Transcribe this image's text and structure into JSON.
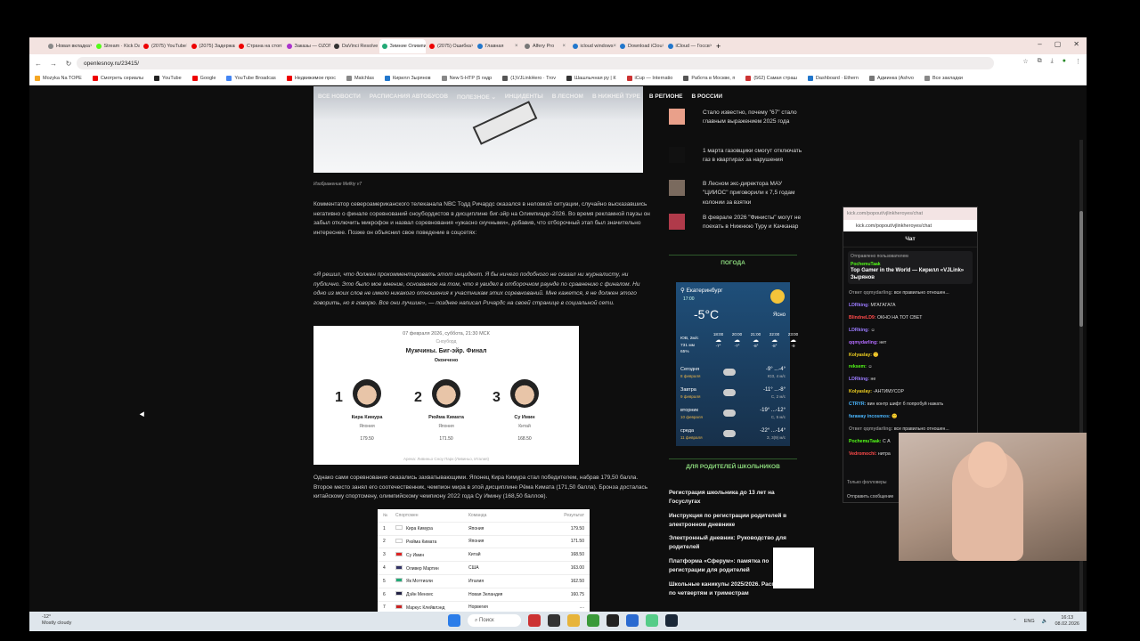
{
  "browser": {
    "tabs": [
      {
        "label": "Новая вкладка",
        "color": "#888"
      },
      {
        "label": "Stream · Kick Da",
        "color": "#53fc18"
      },
      {
        "label": "(2075) YouTube",
        "color": "#e00"
      },
      {
        "label": "(2075) Задержан",
        "color": "#e00"
      },
      {
        "label": "Страна на стоп",
        "color": "#e00"
      },
      {
        "label": "Заказы — OZON",
        "color": "#a3c"
      },
      {
        "label": "DaVinci Resolve",
        "color": "#333"
      },
      {
        "label": "Зимние Олимпи",
        "color": "#2a7"
      },
      {
        "label": "(2075) Ошибка",
        "color": "#e00"
      },
      {
        "label": "Главная",
        "color": "#27c"
      },
      {
        "label": "Alfery Pro",
        "color": "#777"
      },
      {
        "label": "icloud windows",
        "color": "#27c"
      },
      {
        "label": "Download iClou",
        "color": "#27c"
      },
      {
        "label": "iCloud — Госсв",
        "color": "#27c"
      }
    ],
    "active_tab_index": 7,
    "url": "openlesnoy.ru/23415/",
    "bookmarks": [
      "Mozyka Na TOPE",
      "Смотреть сериалы",
      "YouTube",
      "Google",
      "YouTube Broadcas",
      "Недвижимое прос",
      "Matchlas",
      "Кирилл Зырянов",
      "New 5-HTP (5 гидр",
      "(1)VJLinkHero · Trov",
      "Шашлычная ру | К",
      "iCup — Internatio",
      "Работа в Москве, п",
      "(562) Самая страш",
      "Dashboard · Ethern",
      "Админка (Ashvo",
      "Все закладки"
    ]
  },
  "site": {
    "nav": [
      "ВСЕ НОВОСТИ",
      "РАСПИСАНИЯ АВТОБУСОВ",
      "ПОЛЕЗНОЕ ⌄",
      "ИНЦИДЕНТЫ",
      "В ЛЕСНОМ",
      "В НИЖНЕЙ ТУРЕ",
      "В РЕГИОНЕ",
      "В РОССИИ"
    ],
    "caption": "Изображение Mefkiy v7",
    "paragraph1": "Комментатор североамериканского телеканала NBC Тодд Ричардс оказался в неловкой ситуации, случайно высказавшись негативно о финале соревнований сноубордистов в дисциплине биг-эйр на Олимпиаде-2026. Во время рекламной паузы он забыл отключить микрофон и назвал соревнования «ужасно скучными», добавив, что отборочный этап был значительно интереснее. Позже он объяснил свое поведение в соцсетях:",
    "quote": "«Я решил, что должен прокомментировать этот инцидент. Я бы ничего подобного не сказал ни журналисту, ни публично. Это было мое мнение, основанное на том, что я увидел в отборочном раунде по сравнению с финалом. Ни одно из моих слов не имело никакого отношения к участникам этих соревнований. Мне кажется, я не должен этого говорить, но я говорю. Все они лучшие», — позднее написал Ричардс на своей странице в социальной сети.",
    "result_card": {
      "date": "07 февраля 2026, суббота, 21:30 МСК",
      "sport": "Сноуборд",
      "title": "Мужчины. Биг-эйр. Финал",
      "status": "Окончено",
      "podium": [
        {
          "place": "1",
          "name": "Кира Кимура",
          "country": "Япония",
          "score": "179.50"
        },
        {
          "place": "2",
          "name": "Рюйма Кимата",
          "country": "Япония",
          "score": "171.50"
        },
        {
          "place": "3",
          "name": "Су Имин",
          "country": "Китай",
          "score": "168.50"
        }
      ],
      "venue": "Арена: Ливиньо Сноу Парк (Ливиньо, Италия)"
    },
    "paragraph2": "Однако сами соревнования оказались захватывающими. Японец Кира Кимура стал победителем, набрав 179,50 балла. Второе место занял его соотечественник, чемпион мира в этой дисциплине Рёма Кимата (171,50 балла). Бронза досталась китайскому спортсмену, олимпийскому чемпиону 2022 года Су Имину (168,50 баллов).",
    "results_table": {
      "headers": [
        "№",
        "Спортсмен",
        "Команда",
        "Результат"
      ],
      "rows": [
        [
          "1",
          "Кира Кимура",
          "Япония",
          "179.50"
        ],
        [
          "2",
          "Рюйма Кимата",
          "Япония",
          "171.50"
        ],
        [
          "3",
          "Су Имин",
          "Китай",
          "168.50"
        ],
        [
          "4",
          "Оливер Мартин",
          "США",
          "163.00"
        ],
        [
          "5",
          "Як Моттиоли",
          "Италия",
          "162.50"
        ],
        [
          "6",
          "Дэйн Менхес",
          "Новая Зеландия",
          "160.75"
        ],
        [
          "7",
          "Маркус Клейвлэнд",
          "Норвегия",
          "...."
        ]
      ]
    },
    "sidebar_news": [
      "Стало известно, почему \"67\" стало главным выражением 2025 года",
      "1 марта газовщики смогут отключать газ в квартирах за нарушения",
      "В Лесном экс-директора МАУ \"ЦИИОС\" приговорили к 7,5 годам колонии за взятки",
      "В феврале 2026 \"Финисты\" могут не поехать в Нижнюю Туру и Качканар"
    ],
    "weather_title": "ПОГОДА",
    "weather": {
      "city": "Екатеринбург",
      "time": "17:00",
      "temp": "-5°C",
      "cond": "Ясно",
      "details": [
        "ЮВ, 2м/с",
        "731 мм",
        "65%"
      ],
      "hours": [
        {
          "t": "18:00",
          "v": "-7°"
        },
        {
          "t": "20:00",
          "v": "-7°"
        },
        {
          "t": "21:00",
          "v": "-8°"
        },
        {
          "t": "22:00",
          "v": "-8°"
        },
        {
          "t": "23:00",
          "v": "-9"
        }
      ],
      "days": [
        {
          "name": "Сегодня",
          "date": "8 февраля",
          "temp": "-9° ...-4°",
          "wind": "ЮЗ, 4 м/с"
        },
        {
          "name": "Завтра",
          "date": "9 февраля",
          "temp": "-11° ...-8°",
          "wind": "С, 2 м/с"
        },
        {
          "name": "вторник",
          "date": "10 февраля",
          "temp": "-19° ...-12°",
          "wind": "С, 5 м/с"
        },
        {
          "name": "среда",
          "date": "11 февраля",
          "temp": "-22° ...-14°",
          "wind": "З, 3(9) м/с"
        }
      ]
    },
    "parents_title": "ДЛЯ РОДИТЕЛЕЙ ШКОЛЬНИКОВ",
    "parents_links": [
      "Регистрация школьника до 13 лет на Госуслугах",
      "Инструкция по регистрации родителей в электронном дневнике",
      "Электронный дневник: Руководство для родителей",
      "Платформа «Сферум»: памятка по регистрации для родителей",
      "Школьные каникулы 2025/2026. Расписание по четвертям и триместрам"
    ]
  },
  "chat": {
    "window_title": "kick.com/popout/vjlinkheroyes/chat",
    "url": "kick.com/popout/vjlinkheroyes/chat",
    "heading": "Чат",
    "pinned_label": "Отправлено пользователем",
    "pinned_user": "PochemuTaak",
    "pinned_text": "Top Gamer in the World — Кирилл «VJLink» Зырянов",
    "messages": [
      {
        "user": "Ответ qqmydarling:",
        "text": "все правильно отношен...",
        "color": "#888"
      },
      {
        "user": "LDRking:",
        "text": "МГАГАГАГА",
        "color": "#9b7bff"
      },
      {
        "user": "BlindneLD9:",
        "text": "ОКНО НА ТОТ СВЕТ",
        "color": "#ff4a4a"
      },
      {
        "user": "LDRking:",
        "text": "☺",
        "color": "#9b7bff"
      },
      {
        "user": "qqmydarling:",
        "text": "нет",
        "color": "#b36bff"
      },
      {
        "user": "Kolyaslay:",
        "text": "🙂",
        "color": "#f0d020"
      },
      {
        "user": "reksem:",
        "text": "☺",
        "color": "#53fc18"
      },
      {
        "user": "LDRking:",
        "text": "не",
        "color": "#9b7bff"
      },
      {
        "user": "Kolyaslay:",
        "text": "-АНТИМУСОР",
        "color": "#f0d020"
      },
      {
        "user": "CTRYR:",
        "text": "вин контр шифт б попробуй нажать",
        "color": "#4ab7ff"
      },
      {
        "user": "faraway incosmos:",
        "text": "🙂",
        "color": "#4ab7ff"
      },
      {
        "user": "Ответ qqmydarling:",
        "text": "все правильно отношен...",
        "color": "#888"
      },
      {
        "user": "PochemuTaak:",
        "text": "С А",
        "color": "#53fc18"
      },
      {
        "user": "Vedromochi:",
        "text": "нитра",
        "color": "#ff4a4a"
      }
    ],
    "footer_note": "Только фолловеры",
    "send_placeholder": "Отправить сообщение"
  },
  "taskbar": {
    "temp": "-12°",
    "weather": "Mostly cloudy",
    "search": "Поиск",
    "lang": "ENG",
    "time": "16:13",
    "date": "08.02.2026"
  }
}
